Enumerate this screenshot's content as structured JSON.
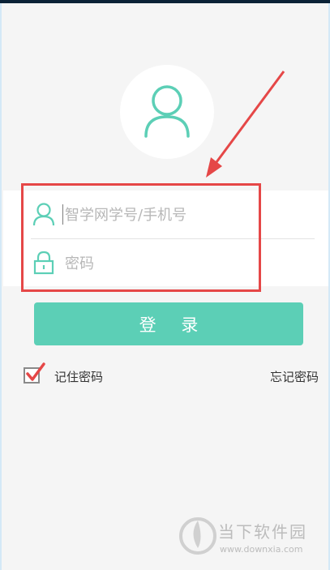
{
  "login_form": {
    "username_placeholder": "智学网学号/手机号",
    "password_placeholder": "密码"
  },
  "actions": {
    "login_label": "登 录",
    "remember_label": "记住密码",
    "remember_checked": true,
    "forgot_label": "忘记密码"
  },
  "icons": {
    "avatar": "user-avatar-icon",
    "username": "user-icon",
    "password": "lock-icon",
    "checkbox": "checkmark-icon",
    "watermark_logo": "downxia-logo-icon"
  },
  "watermark": {
    "brand": "当下软件园",
    "url": "www.downxia.com"
  },
  "colors": {
    "accent": "#5ccfb6",
    "annotation_red": "#e54747",
    "background": "#f5f5f5"
  }
}
